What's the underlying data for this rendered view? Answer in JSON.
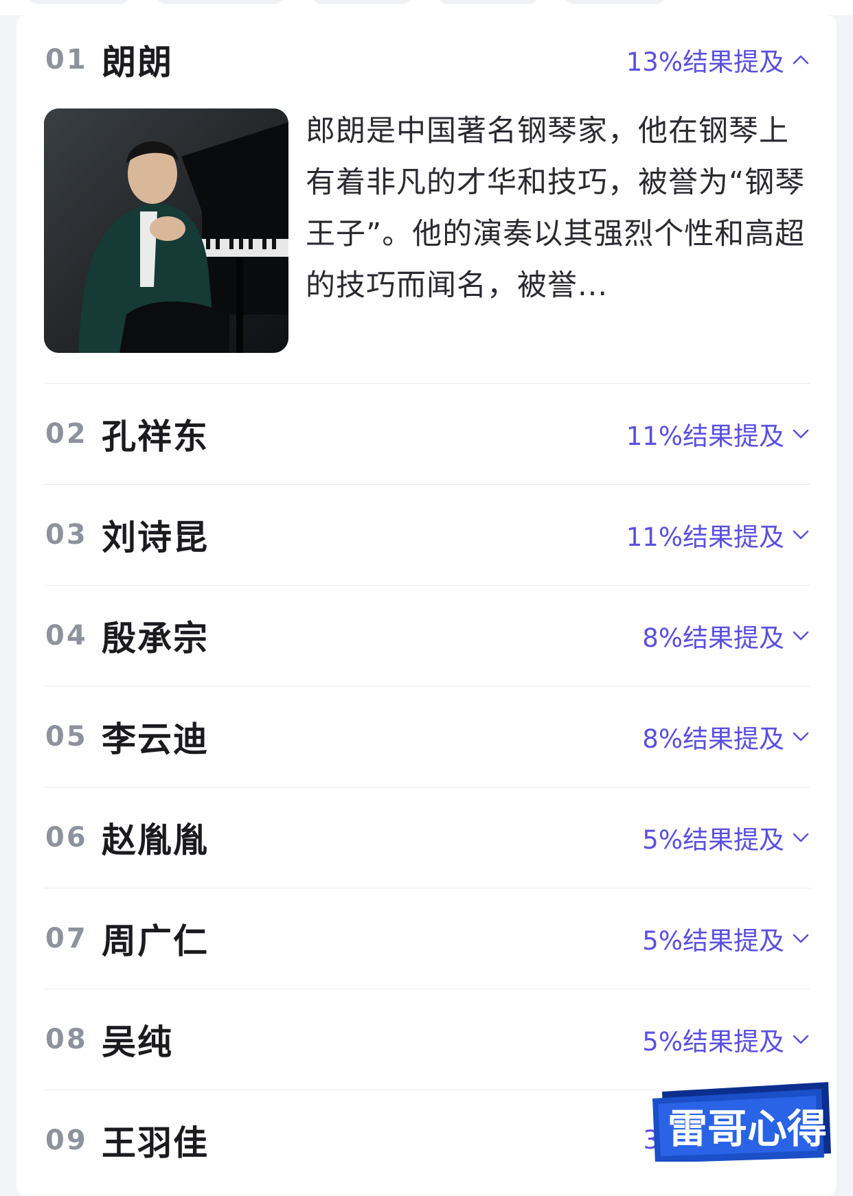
{
  "list": {
    "items": [
      {
        "rank": "01",
        "name": "朗朗",
        "mention": "13%结果提及",
        "expanded": true,
        "description": "郎朗是中国著名钢琴家，他在钢琴上有着非凡的才华和技巧，被誉为“钢琴王子”。他的演奏以其强烈个性和高超的技巧而闻名，被誉..."
      },
      {
        "rank": "02",
        "name": "孔祥东",
        "mention": "11%结果提及",
        "expanded": false
      },
      {
        "rank": "03",
        "name": "刘诗昆",
        "mention": "11%结果提及",
        "expanded": false
      },
      {
        "rank": "04",
        "name": "殷承宗",
        "mention": "8%结果提及",
        "expanded": false
      },
      {
        "rank": "05",
        "name": "李云迪",
        "mention": "8%结果提及",
        "expanded": false
      },
      {
        "rank": "06",
        "name": "赵胤胤",
        "mention": "5%结果提及",
        "expanded": false
      },
      {
        "rank": "07",
        "name": "周广仁",
        "mention": "5%结果提及",
        "expanded": false
      },
      {
        "rank": "08",
        "name": "吴纯",
        "mention": "5%结果提及",
        "expanded": false
      },
      {
        "rank": "09",
        "name": "王羽佳",
        "mention": "3",
        "expanded": false
      }
    ]
  },
  "watermark": {
    "text": "雷哥心得"
  },
  "colors": {
    "accent": "#5a4fe0",
    "rank": "#8e929c",
    "name_highlight": "#ebe9ff",
    "badge": "#1a4fc7"
  },
  "icons": {
    "expanded": "chevron-up-icon",
    "collapsed": "chevron-down-icon"
  }
}
